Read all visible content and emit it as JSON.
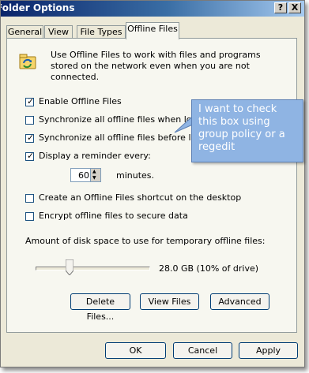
{
  "window": {
    "title": "Folder Options",
    "help_label": "?",
    "close_label": "X"
  },
  "tabs": [
    {
      "label": "General",
      "active": false
    },
    {
      "label": "View",
      "active": false
    },
    {
      "label": "File Types",
      "active": false
    },
    {
      "label": "Offline Files",
      "active": true
    }
  ],
  "panel": {
    "description": "Use Offline Files to work with files and programs stored on the network even when you are not connected.",
    "options": [
      {
        "label": "Enable Offline Files",
        "checked": true
      },
      {
        "label": "Synchronize all offline files when logging o",
        "checked": false
      },
      {
        "label": "Synchronize all offline files before logging o",
        "checked": true
      },
      {
        "label": "Display a reminder every:",
        "checked": true
      }
    ],
    "reminder_value": "60",
    "reminder_unit": "minutes.",
    "extra_options": [
      {
        "label": "Create an Offline Files shortcut on the desktop",
        "checked": false
      },
      {
        "label": "Encrypt offline files to secure data",
        "checked": false
      }
    ],
    "disk_label": "Amount of disk space to use for temporary offline files:",
    "disk_value": "28.0 GB (10% of drive)",
    "disk_fraction": 0.1,
    "buttons": {
      "delete": "Delete Files...",
      "view": "View Files",
      "advanced": "Advanced"
    }
  },
  "footer": {
    "ok": "OK",
    "cancel": "Cancel",
    "apply": "Apply"
  },
  "callout": {
    "text": "I want to check this box using group policy or a regedit"
  },
  "colors": {
    "titlebar": "#0a246a",
    "callout": "#8fb4e3",
    "button_border": "#003c74"
  }
}
